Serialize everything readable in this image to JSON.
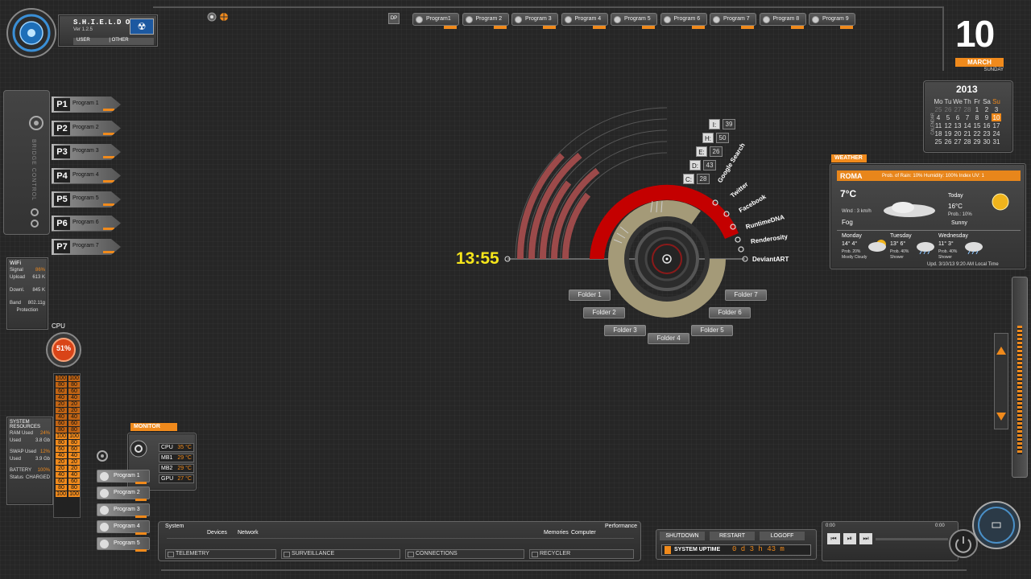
{
  "header": {
    "os_name": "S.H.I.E.L.D OS",
    "version": "Ver 1.2.5",
    "user_label": "USER",
    "other_label": "OTHER",
    "dp_label": "DP",
    "tabs": [
      "Program1",
      "Program 2",
      "Program 3",
      "Program 4",
      "Program 5",
      "Program 6",
      "Program 7",
      "Program 8",
      "Program 9"
    ]
  },
  "date": {
    "day": "10",
    "month": "MARCH",
    "weekday": "SUNDAY",
    "year": "2013",
    "calendar_label": "CALENDAR",
    "weekdays": [
      "Mo",
      "Tu",
      "We",
      "Th",
      "Fr",
      "Sa",
      "Su"
    ],
    "weeks": [
      [
        "25",
        "26",
        "27",
        "28",
        "1",
        "2",
        "3"
      ],
      [
        "4",
        "5",
        "6",
        "7",
        "8",
        "9",
        "10"
      ],
      [
        "11",
        "12",
        "13",
        "14",
        "15",
        "16",
        "17"
      ],
      [
        "18",
        "19",
        "20",
        "21",
        "22",
        "23",
        "24"
      ],
      [
        "25",
        "26",
        "27",
        "28",
        "29",
        "30",
        "31"
      ]
    ]
  },
  "left_programs": {
    "title": "BRIDGE CONTROL",
    "items": [
      {
        "num": "P1",
        "label": "Program 1"
      },
      {
        "num": "P2",
        "label": "Program 2"
      },
      {
        "num": "P3",
        "label": "Program 3"
      },
      {
        "num": "P4",
        "label": "Program 4"
      },
      {
        "num": "P5",
        "label": "Program 5"
      },
      {
        "num": "P6",
        "label": "Program 6"
      },
      {
        "num": "P7",
        "label": "Program 7"
      }
    ]
  },
  "wifi": {
    "title": "WiFi",
    "signal_label": "Signal",
    "signal": "86%",
    "upload_label": "Upload",
    "upload": "613 K",
    "down_label": "Downl.",
    "down": "845 K",
    "band_label": "Band",
    "band": "802.11g",
    "protection_label": "Protection"
  },
  "cpu": {
    "title": "CPU",
    "value": "51%"
  },
  "system_resources": {
    "title": "SYSTEM RESOURCES",
    "ram_label": "RAM Used",
    "ram_pct": "24%",
    "ram_used_label": "Used",
    "ram_used": "3.8 Gb",
    "swap_label": "SWAP Used",
    "swap_pct": "12%",
    "swap_used_label": "Used",
    "swap_used": "3.9 Gb",
    "battery_label": "BATTERY",
    "battery": "100%",
    "status_label": "Status",
    "status": "CHARGED"
  },
  "bars": {
    "col_a": [
      "100",
      "80",
      "60",
      "40",
      "20",
      "20",
      "40",
      "60",
      "80",
      "100",
      "80",
      "60",
      "40",
      "20",
      "20",
      "40",
      "60",
      "80",
      "100"
    ],
    "col_b": [
      "100",
      "80",
      "60",
      "40",
      "20",
      "20",
      "40",
      "60",
      "80",
      "100",
      "80",
      "60",
      "40",
      "20",
      "20",
      "40",
      "60",
      "80",
      "100"
    ]
  },
  "monitor": {
    "title": "MONITOR",
    "rows": [
      {
        "label": "CPU",
        "value": "35 °C"
      },
      {
        "label": "MB1",
        "value": "29 °C"
      },
      {
        "label": "MB2",
        "value": "29 °C"
      },
      {
        "label": "GPU",
        "value": "27 °C"
      }
    ]
  },
  "bottom_programs": [
    "Program 1",
    "Program 2",
    "Program 3",
    "Program 4",
    "Program 5"
  ],
  "clock": {
    "time": "13:55"
  },
  "drives": [
    {
      "letter": "I:",
      "value": "39"
    },
    {
      "letter": "H:",
      "value": "50"
    },
    {
      "letter": "E:",
      "value": "26"
    },
    {
      "letter": "D:",
      "value": "43"
    },
    {
      "letter": "C:",
      "value": "28"
    }
  ],
  "links": [
    "Google Search",
    "Twitter",
    "Facebook",
    "RuntimeDNA",
    "Renderosity",
    "DeviantART"
  ],
  "folders": [
    "Folder 1",
    "Folder 2",
    "Folder 3",
    "Folder 4",
    "Folder 5",
    "Folder 6",
    "Folder 7"
  ],
  "weather": {
    "title": "WEATHER",
    "city": "ROMA",
    "stats": "Prob. of Rain: 10%  Humidity: 100%  Index UV: 1",
    "now_temp": "7°C",
    "wind": "Wind : 3 km/h",
    "now_cond": "Fog",
    "today_label": "Today",
    "today_temp": "16°C",
    "today_prob": "Prob.: 10%",
    "today_cond": "Sunny",
    "forecast": [
      {
        "day": "Monday",
        "temps": "14°  4°",
        "prob": "Prob. 20%",
        "cond": "Mostly Cloudy"
      },
      {
        "day": "Tuesday",
        "temps": "13°  6°",
        "prob": "Prob. 40%",
        "cond": "Shower"
      },
      {
        "day": "Wednesday",
        "temps": "11°  3°",
        "prob": "Prob. 40%",
        "cond": "Shower"
      }
    ],
    "updated": "Upd. 3/10/13 9:20 AM  Local Time"
  },
  "bottom_bar": {
    "system": "System",
    "devices": "Devices",
    "network": "Network",
    "memories": "Memories",
    "computer": "Computer",
    "performance": "Performance",
    "telemetry": "TELEMETRY",
    "surveillance": "SURVEILLANCE",
    "connections": "CONNECTIONS",
    "recycler": "RECYCLER"
  },
  "power": {
    "shutdown": "SHUTDOWN",
    "restart": "RESTART",
    "logoff": "LOGOFF",
    "uptime_label": "SYSTEM UPTIME",
    "uptime": "0 d  3 h 43 m"
  },
  "media": {
    "time_start": "0:00",
    "time_end": "0:00"
  },
  "colors": {
    "accent": "#f08a1c",
    "alert_red": "#c40000",
    "clock_yellow": "#f5e51b"
  }
}
